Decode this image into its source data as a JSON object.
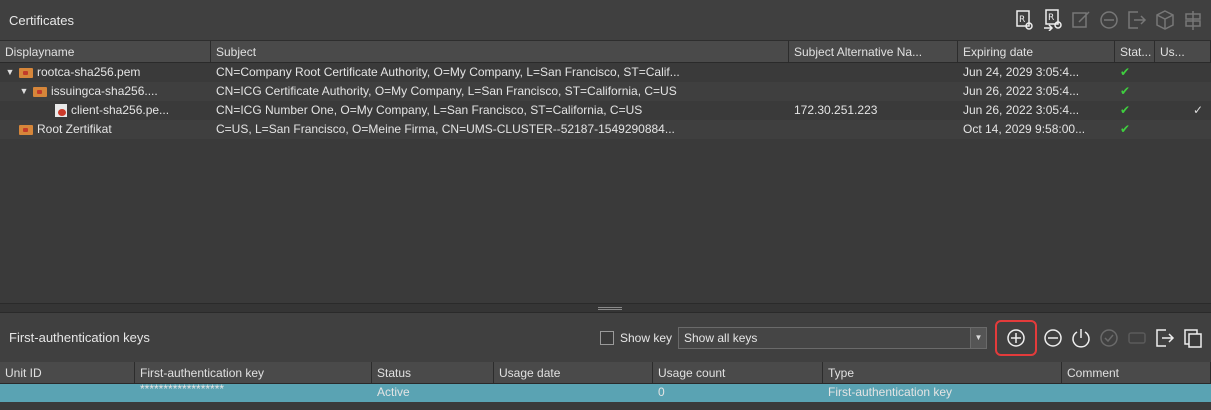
{
  "certificates": {
    "title": "Certificates",
    "columns": [
      "Displayname",
      "Subject",
      "Subject Alternative Na...",
      "Expiring date",
      "Stat...",
      "Us..."
    ],
    "rows": [
      {
        "name": "rootca-sha256.pem",
        "subject": "CN=Company Root Certificate Authority, O=My Company, L=San Francisco, ST=Calif...",
        "san": "",
        "expiry": "Jun 24, 2029 3:05:4...",
        "status": "✔",
        "used": ""
      },
      {
        "name": "issuingca-sha256....",
        "subject": "CN=ICG Certificate Authority, O=My Company, L=San Francisco, ST=California, C=US",
        "san": "",
        "expiry": "Jun 26, 2022 3:05:4...",
        "status": "✔",
        "used": ""
      },
      {
        "name": "client-sha256.pe...",
        "subject": "CN=ICG Number One, O=My Company, L=San Francisco, ST=California, C=US",
        "san": "172.30.251.223",
        "expiry": "Jun 26, 2022 3:05:4...",
        "status": "✔",
        "used": "✓"
      },
      {
        "name": "Root Zertifikat",
        "subject": "C=US, L=San Francisco, O=Meine Firma, CN=UMS-CLUSTER--52187-1549290884...",
        "san": "",
        "expiry": "Oct 14, 2029 9:58:00...",
        "status": "✔",
        "used": ""
      }
    ],
    "toolbar_icons": [
      "import-cert-icon",
      "export-cert-icon",
      "edit-cert-icon",
      "remove-icon",
      "export-icon",
      "package-icon",
      "signpost-icon"
    ]
  },
  "keys": {
    "title": "First-authentication keys",
    "show_key_label": "Show key",
    "filter_value": "Show all keys",
    "columns": [
      "Unit ID",
      "First-authentication key",
      "Status",
      "Usage date",
      "Usage count",
      "Type",
      "Comment"
    ],
    "rows": [
      {
        "unit_id": "",
        "key": "******************",
        "status": "Active",
        "usage_date": "",
        "usage_count": "0",
        "type": "First-authentication key",
        "comment": ""
      }
    ]
  },
  "colors": {
    "accent_selection": "#5aa3b3",
    "highlight_border": "#e33b3b",
    "status_ok": "#3fcf3f"
  }
}
